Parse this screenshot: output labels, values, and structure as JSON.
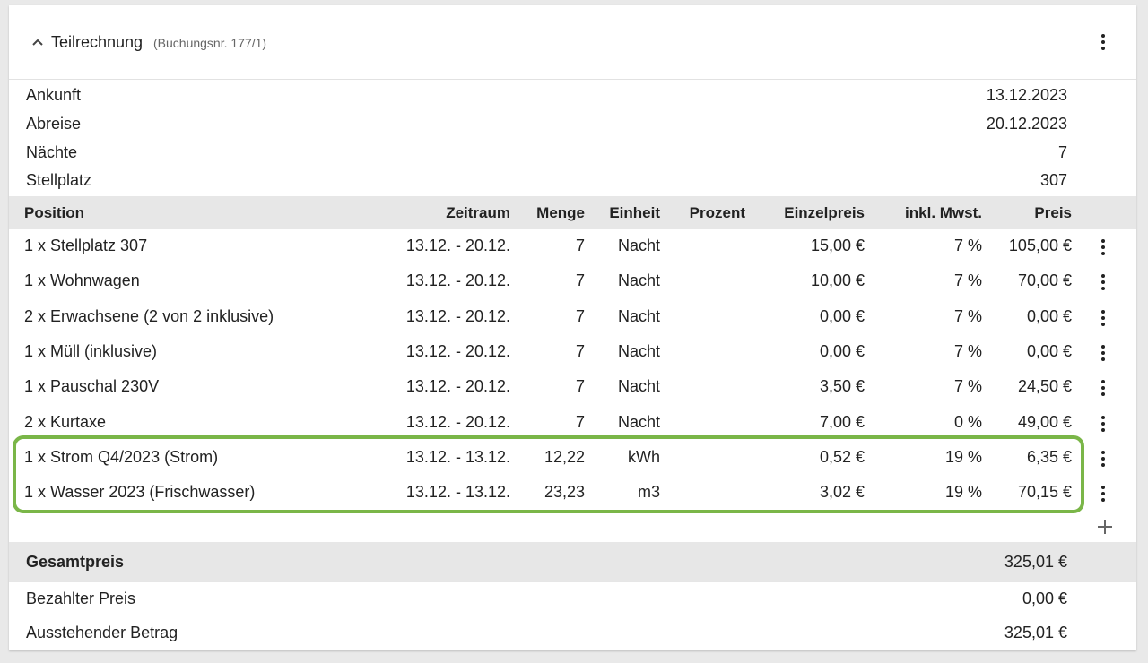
{
  "header": {
    "title": "Teilrechnung",
    "subtitle": "(Buchungsnr. 177/1)",
    "collapse_icon": "chevron-up-icon",
    "menu_icon": "more-vertical-icon"
  },
  "info": [
    {
      "label": "Ankunft",
      "value": "13.12.2023"
    },
    {
      "label": "Abreise",
      "value": "20.12.2023"
    },
    {
      "label": "Nächte",
      "value": "7"
    },
    {
      "label": "Stellplatz",
      "value": "307"
    }
  ],
  "table": {
    "columns": {
      "position": "Position",
      "zeitraum": "Zeitraum",
      "menge": "Menge",
      "einheit": "Einheit",
      "prozent": "Prozent",
      "einzelpreis": "Einzelpreis",
      "mwst": "inkl. Mwst.",
      "preis": "Preis"
    },
    "rows": [
      {
        "position": "1 x Stellplatz 307",
        "zeitraum": "13.12. - 20.12.",
        "menge": "7",
        "einheit": "Nacht",
        "prozent": "",
        "einzelpreis": "15,00 €",
        "mwst": "7 %",
        "preis": "105,00 €"
      },
      {
        "position": "1 x Wohnwagen",
        "zeitraum": "13.12. - 20.12.",
        "menge": "7",
        "einheit": "Nacht",
        "prozent": "",
        "einzelpreis": "10,00 €",
        "mwst": "7 %",
        "preis": "70,00 €"
      },
      {
        "position": "2 x Erwachsene (2 von 2 inklusive)",
        "zeitraum": "13.12. - 20.12.",
        "menge": "7",
        "einheit": "Nacht",
        "prozent": "",
        "einzelpreis": "0,00 €",
        "mwst": "7 %",
        "preis": "0,00 €"
      },
      {
        "position": "1 x Müll (inklusive)",
        "zeitraum": "13.12. - 20.12.",
        "menge": "7",
        "einheit": "Nacht",
        "prozent": "",
        "einzelpreis": "0,00 €",
        "mwst": "7 %",
        "preis": "0,00 €"
      },
      {
        "position": "1 x Pauschal 230V",
        "zeitraum": "13.12. - 20.12.",
        "menge": "7",
        "einheit": "Nacht",
        "prozent": "",
        "einzelpreis": "3,50 €",
        "mwst": "7 %",
        "preis": "24,50 €"
      },
      {
        "position": "2 x Kurtaxe",
        "zeitraum": "13.12. - 20.12.",
        "menge": "7",
        "einheit": "Nacht",
        "prozent": "",
        "einzelpreis": "7,00 €",
        "mwst": "0 %",
        "preis": "49,00 €"
      },
      {
        "position": "1 x Strom Q4/2023 (Strom)",
        "zeitraum": "13.12. - 13.12.",
        "menge": "12,22",
        "einheit": "kWh",
        "prozent": "",
        "einzelpreis": "0,52 €",
        "mwst": "19 %",
        "preis": "6,35 €"
      },
      {
        "position": "1 x Wasser 2023 (Frischwasser)",
        "zeitraum": "13.12. - 13.12.",
        "menge": "23,23",
        "einheit": "m3",
        "prozent": "",
        "einzelpreis": "3,02 €",
        "mwst": "19 %",
        "preis": "70,15 €"
      }
    ],
    "add_icon": "plus-icon",
    "highlight_color": "#7ab648"
  },
  "summary": {
    "total_label": "Gesamtpreis",
    "total_value": "325,01 €",
    "paid_label": "Bezahlter Preis",
    "paid_value": "0,00 €",
    "outstanding_label": "Ausstehender Betrag",
    "outstanding_value": "325,01 €"
  }
}
